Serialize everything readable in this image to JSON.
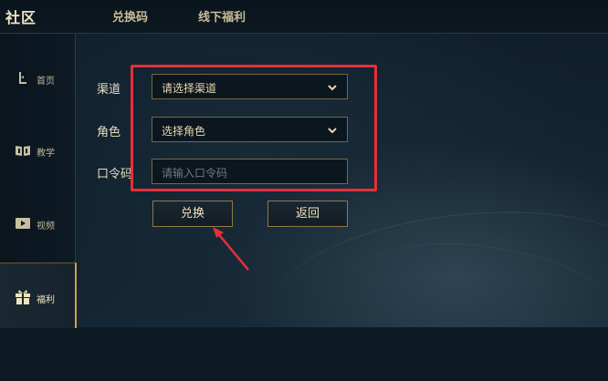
{
  "app": {
    "title": "社区"
  },
  "top_tabs": [
    {
      "label": "兑换码"
    },
    {
      "label": "线下福利"
    }
  ],
  "sidebar": {
    "items": [
      {
        "label": "首页",
        "icon": "home-icon"
      },
      {
        "label": "教学",
        "icon": "book-icon"
      },
      {
        "label": "视频",
        "icon": "video-icon"
      },
      {
        "label": "福利",
        "icon": "gift-icon",
        "active": true
      }
    ]
  },
  "form": {
    "channel_label": "渠道",
    "channel_value": "请选择渠道",
    "role_label": "角色",
    "role_value": "选择角色",
    "code_label": "口令码",
    "code_placeholder": "请输入口令码",
    "code_value": ""
  },
  "buttons": {
    "redeem": "兑换",
    "back": "返回"
  },
  "colors": {
    "accent_gold": "#c8a24a",
    "highlight_red": "#e5303a",
    "background": "#0d1a24"
  }
}
